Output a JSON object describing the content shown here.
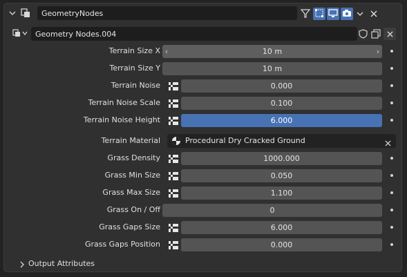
{
  "modifier": {
    "name": "GeometryNodes",
    "node_group": "Geometry Nodes.004"
  },
  "inputs": [
    {
      "label": "Terrain Size X",
      "value": "10 m",
      "kind": "vector"
    },
    {
      "label": "Terrain Size Y",
      "value": "10 m",
      "kind": "plain"
    },
    {
      "label": "Terrain Noise",
      "value": "0.000",
      "kind": "attr"
    },
    {
      "label": "Terrain Noise Scale",
      "value": "0.100",
      "kind": "attr"
    },
    {
      "label": "Terrain Noise Height",
      "value": "6.000",
      "kind": "attr",
      "active": true
    },
    {
      "label": "Terrain Material",
      "value": "Procedural Dry Cracked Ground",
      "kind": "material"
    },
    {
      "label": "Grass Density",
      "value": "1000.000",
      "kind": "attr"
    },
    {
      "label": "Grass Min Size",
      "value": "0.050",
      "kind": "attr"
    },
    {
      "label": "Grass Max Size",
      "value": "1.100",
      "kind": "attr"
    },
    {
      "label": "Grass On / Off",
      "value": "0",
      "kind": "plain"
    },
    {
      "label": "Grass Gaps Size",
      "value": "6.000",
      "kind": "attr"
    },
    {
      "label": "Grass Gaps Position",
      "value": "0.000",
      "kind": "attr"
    }
  ],
  "footer": {
    "label": "Output Attributes"
  },
  "icons": {
    "collapse": "chevron-down-icon",
    "modifier_type": "geometry-nodes-icon",
    "edit_mode": "funnel-icon",
    "cage": "vertices-icon",
    "realtime": "monitor-icon",
    "render": "camera-icon",
    "expand": "chevron-down-icon",
    "close": "close-icon",
    "fake_user": "shield-icon",
    "duplicate": "duplicate-icon",
    "unlink": "close-icon"
  },
  "colors": {
    "accent": "#4772b3",
    "panel": "#303030",
    "field": "#545454",
    "background": "#232323"
  }
}
